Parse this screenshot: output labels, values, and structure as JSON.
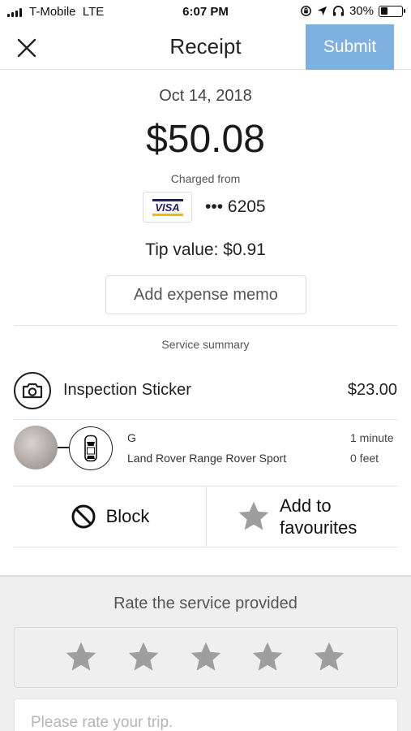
{
  "status_bar": {
    "carrier": "T-Mobile",
    "network": "LTE",
    "time": "6:07 PM",
    "battery": "30%",
    "battery_level": 0.3,
    "icons": [
      "signal-icon",
      "lock-rotation-icon",
      "location-arrow-icon",
      "headphones-icon",
      "battery-icon"
    ]
  },
  "header": {
    "title": "Receipt",
    "submit_label": "Submit",
    "close_icon": "close-icon"
  },
  "receipt": {
    "date": "Oct 14, 2018",
    "amount": "$50.08",
    "charged_label": "Charged from",
    "card_brand": "VISA",
    "card_digits": "••• 6205",
    "tip": "Tip value: $0.91",
    "memo_button": "Add expense memo"
  },
  "summary": {
    "label": "Service summary",
    "item": {
      "icon": "camera-icon",
      "name": "Inspection Sticker",
      "price": "$23.00"
    }
  },
  "driver": {
    "name": "G",
    "vehicle": "Land Rover Range Rover Sport",
    "eta": "1 minute",
    "distance": "0 feet"
  },
  "actions": {
    "block_label": "Block",
    "favourites_label": "Add to favourites"
  },
  "rating": {
    "label": "Rate the service provided",
    "stars_total": 5,
    "stars_selected": 0,
    "input_placeholder": "Please rate your trip."
  },
  "colors": {
    "submit_bg": "#7fb1e0",
    "star": "#9e9e9e",
    "rating_bg": "#efefef",
    "visa_blue": "#1a1f71",
    "visa_gold": "#f7b600"
  }
}
